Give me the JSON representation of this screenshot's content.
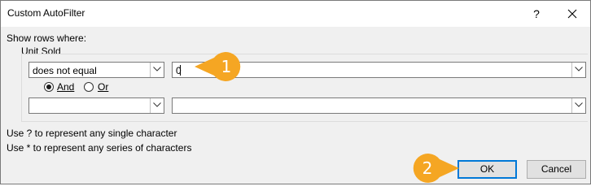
{
  "dialog": {
    "title": "Custom AutoFilter",
    "help_glyph": "?",
    "close_glyph": "✕"
  },
  "criteria": {
    "show_rows_label": "Show rows where:",
    "field_name": "Unit Sold",
    "row1": {
      "operator": "does not equal",
      "value": "0"
    },
    "logic": {
      "and_label": "And",
      "or_label": "Or",
      "selected": "And"
    },
    "row2": {
      "operator": "",
      "value": ""
    }
  },
  "hints": [
    "Use ? to represent any single character",
    "Use * to represent any series of characters"
  ],
  "buttons": {
    "ok": "OK",
    "cancel": "Cancel"
  },
  "callouts": [
    {
      "number": "1"
    },
    {
      "number": "2"
    }
  ],
  "colors": {
    "callout": "#f5a623",
    "default_button_border": "#0078d7"
  }
}
